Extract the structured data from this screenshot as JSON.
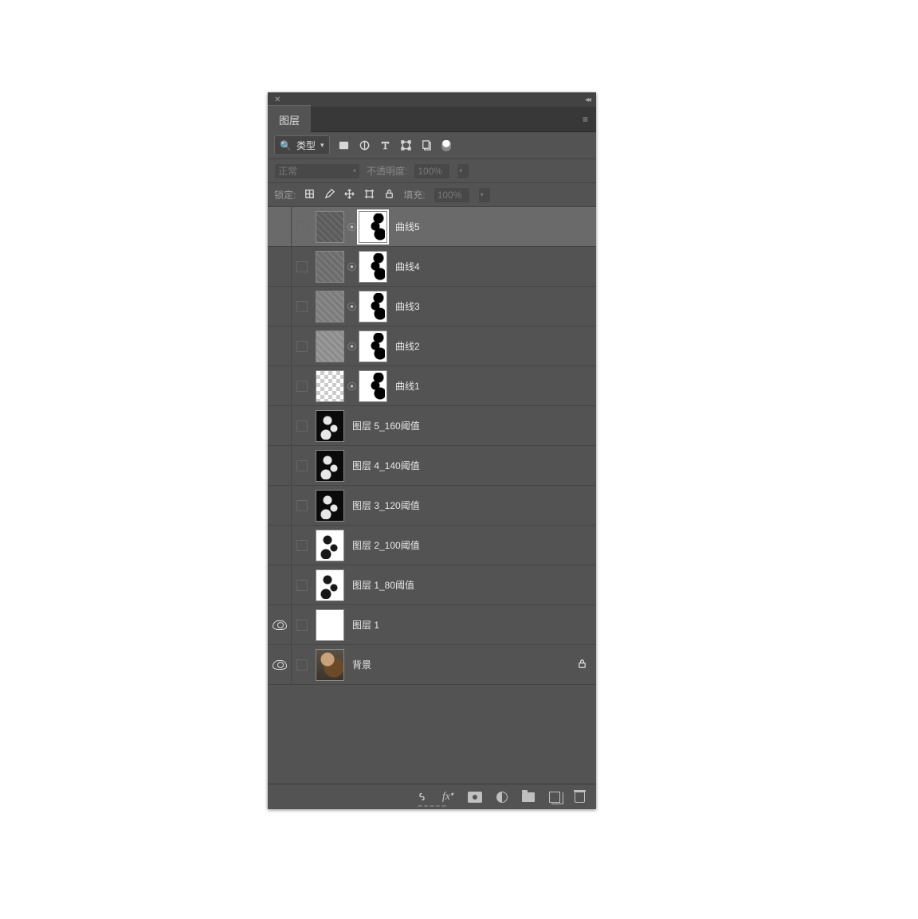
{
  "panel": {
    "tab_label": "图层",
    "filter_label": "类型",
    "blend_mode": "正常",
    "opacity_label": "不透明度:",
    "opacity_value": "100%",
    "lock_label": "锁定:",
    "fill_label": "填充:",
    "fill_value": "100%"
  },
  "layers": [
    {
      "name": "曲线5",
      "type": "adjustment",
      "visible": false,
      "selected": true,
      "thumb": "pattern1",
      "mask": true,
      "locked": false
    },
    {
      "name": "曲线4",
      "type": "adjustment",
      "visible": false,
      "selected": false,
      "thumb": "pattern2",
      "mask": true,
      "locked": false
    },
    {
      "name": "曲线3",
      "type": "adjustment",
      "visible": false,
      "selected": false,
      "thumb": "pattern3",
      "mask": true,
      "locked": false
    },
    {
      "name": "曲线2",
      "type": "adjustment",
      "visible": false,
      "selected": false,
      "thumb": "pattern4",
      "mask": true,
      "locked": false
    },
    {
      "name": "曲线1",
      "type": "adjustment",
      "visible": false,
      "selected": false,
      "thumb": "trans",
      "mask": true,
      "locked": false
    },
    {
      "name": "图层 5_160阈值",
      "type": "pixel",
      "visible": false,
      "selected": false,
      "thumb": "dark",
      "mask": false,
      "locked": false
    },
    {
      "name": "图层 4_140阈值",
      "type": "pixel",
      "visible": false,
      "selected": false,
      "thumb": "dark",
      "mask": false,
      "locked": false
    },
    {
      "name": "图层 3_120阈值",
      "type": "pixel",
      "visible": false,
      "selected": false,
      "thumb": "dark",
      "mask": false,
      "locked": false
    },
    {
      "name": "图层 2_100阈值",
      "type": "pixel",
      "visible": false,
      "selected": false,
      "thumb": "light",
      "mask": false,
      "locked": false
    },
    {
      "name": "图层 1_80阈值",
      "type": "pixel",
      "visible": false,
      "selected": false,
      "thumb": "light",
      "mask": false,
      "locked": false
    },
    {
      "name": "图层 1",
      "type": "pixel",
      "visible": true,
      "selected": false,
      "thumb": "white",
      "mask": false,
      "locked": false
    },
    {
      "name": "背景",
      "type": "pixel",
      "visible": true,
      "selected": false,
      "thumb": "photo",
      "mask": false,
      "locked": true
    }
  ]
}
